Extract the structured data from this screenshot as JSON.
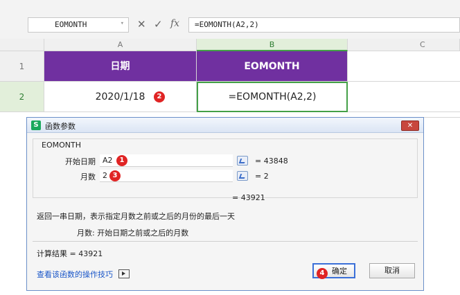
{
  "formula_bar": {
    "name_box": "EOMONTH",
    "cancel_icon": "✕",
    "confirm_icon": "✓",
    "fx_icon": "fx",
    "formula": "=EOMONTH(A2,2)"
  },
  "sheet": {
    "columns": [
      "A",
      "B",
      "C"
    ],
    "rows": [
      "1",
      "2"
    ],
    "header_row": [
      "日期",
      "EOMONTH"
    ],
    "data_row": [
      "2020/1/18",
      "=EOMONTH(A2,2)"
    ],
    "header_color": "#7030a0"
  },
  "badges": {
    "one": "1",
    "two": "2",
    "three": "3",
    "four": "4"
  },
  "dialog": {
    "app_icon": "S",
    "title": "函数参数",
    "close": "✕",
    "function_name": "EOMONTH",
    "args": [
      {
        "label": "开始日期",
        "value": "A2",
        "result": "= 43848"
      },
      {
        "label": "月数",
        "value": "2",
        "result": "= 2"
      }
    ],
    "preview_result": "= 43921",
    "description": "返回一串日期，表示指定月数之前或之后的月份的最后一天",
    "param_help": "月数:  开始日期之前或之后的月数",
    "calc_result": "计算结果 = 43921",
    "help_link": "查看该函数的操作技巧",
    "ok_label": "确定",
    "cancel_label": "取消"
  }
}
